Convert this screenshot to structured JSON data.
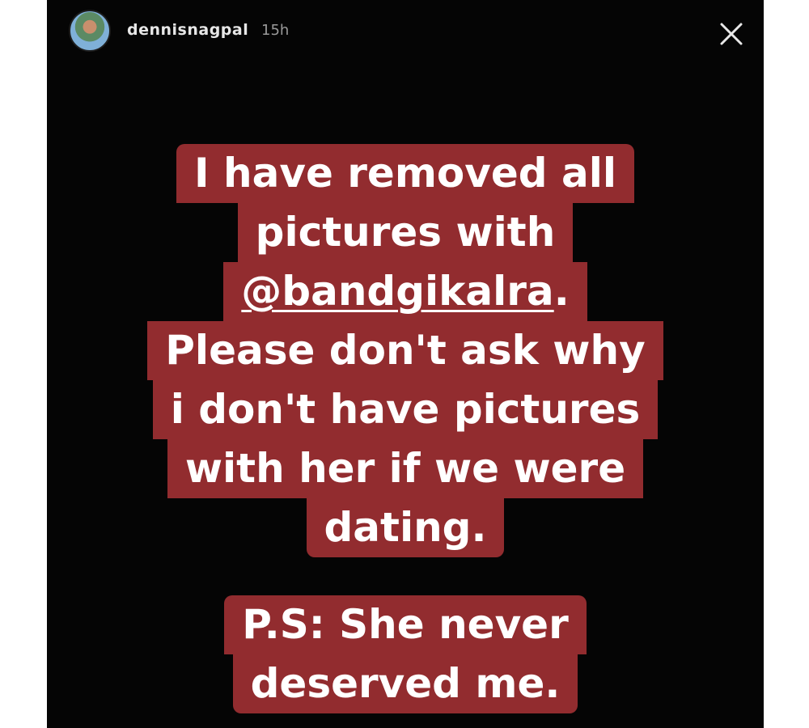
{
  "story": {
    "username": "dennisnagpal",
    "time": "15h",
    "avatar_icon": "profile-avatar",
    "close_icon": "close-icon"
  },
  "caption": {
    "line1": "I have removed all",
    "line2": "pictures with",
    "line3_mention": "@bandgikalra",
    "line3_suffix": ".",
    "line4": "Please don't ask why",
    "line5": "i don't have pictures",
    "line6": "with her if we were",
    "line7": "dating."
  },
  "postscript": {
    "line1": "P.S: She never",
    "line2": "deserved me."
  },
  "colors": {
    "background": "#050505",
    "highlight": "#922c2f",
    "text": "#ffffff"
  }
}
